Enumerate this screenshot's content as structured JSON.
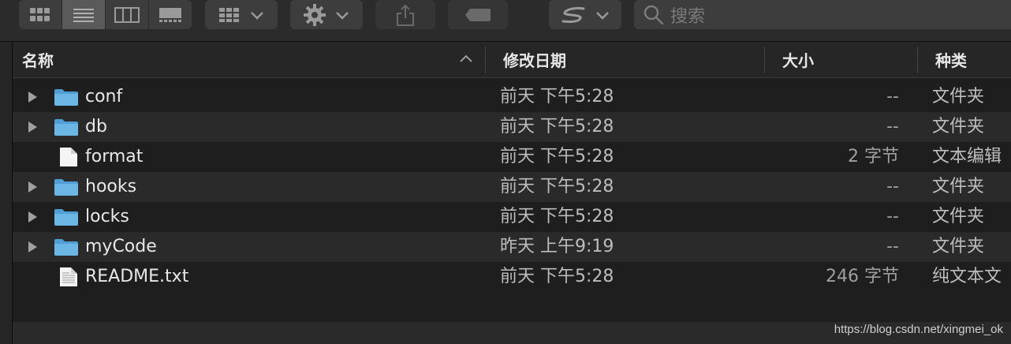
{
  "toolbar": {
    "view_buttons": [
      "icon-view",
      "list-view",
      "column-view",
      "gallery-view"
    ],
    "search_placeholder": "搜索"
  },
  "columns": {
    "name": "名称",
    "date": "修改日期",
    "size": "大小",
    "kind": "种类"
  },
  "files": [
    {
      "name": "conf",
      "date": "前天 下午5:28",
      "size": "--",
      "kind": "文件夹",
      "type": "folder"
    },
    {
      "name": "db",
      "date": "前天 下午5:28",
      "size": "--",
      "kind": "文件夹",
      "type": "folder"
    },
    {
      "name": "format",
      "date": "前天 下午5:28",
      "size": "2 字节",
      "kind": "文本编辑",
      "type": "file"
    },
    {
      "name": "hooks",
      "date": "前天 下午5:28",
      "size": "--",
      "kind": "文件夹",
      "type": "folder"
    },
    {
      "name": "locks",
      "date": "前天 下午5:28",
      "size": "--",
      "kind": "文件夹",
      "type": "folder"
    },
    {
      "name": "myCode",
      "date": "昨天 上午9:19",
      "size": "--",
      "kind": "文件夹",
      "type": "folder"
    },
    {
      "name": "README.txt",
      "date": "前天 下午5:28",
      "size": "246 字节",
      "kind": "纯文本文",
      "type": "text"
    }
  ],
  "watermark": "https://blog.csdn.net/xingmei_ok",
  "colors": {
    "folder": "#6cb6e6",
    "folder_dark": "#4f9fd6",
    "accent": "#5a5a5a"
  }
}
